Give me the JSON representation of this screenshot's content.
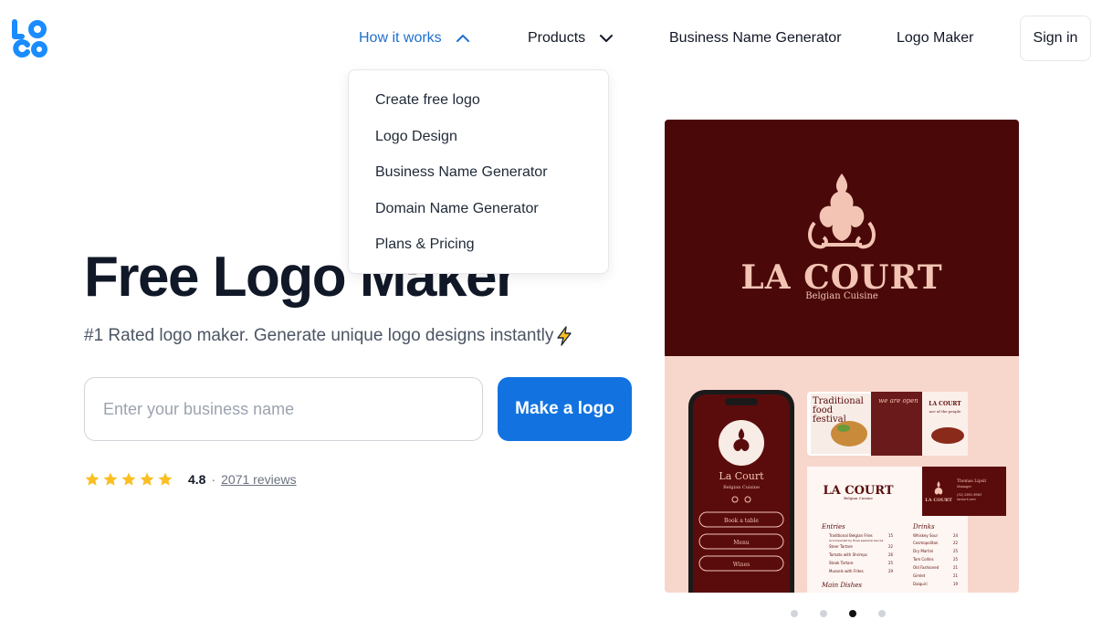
{
  "brand": {
    "logo_letters": [
      "L",
      "O",
      "G",
      "O"
    ],
    "color": "#1a8cff"
  },
  "nav": {
    "how_it_works": "How it works",
    "products": "Products",
    "business_name_generator": "Business Name Generator",
    "logo_maker": "Logo Maker",
    "sign_in": "Sign in",
    "active_color": "#1f6fd1"
  },
  "dropdown": {
    "items": [
      "Create free logo",
      "Logo Design",
      "Business Name Generator",
      "Domain Name Generator",
      "Plans & Pricing"
    ]
  },
  "hero": {
    "title": "Free Logo Maker",
    "subtitle": "#1 Rated logo maker. Generate unique logo designs instantly",
    "input_placeholder": "Enter your business name",
    "input_value": "",
    "cta": "Make a logo",
    "cta_color": "#1273e0"
  },
  "rating": {
    "stars": 5,
    "score": "4.8",
    "separator": "·",
    "reviews": "2071 reviews",
    "star_color": "#fbbf24"
  },
  "showcase": {
    "brand_name": "LA COURT",
    "brand_tagline": "Belgian Cuisine",
    "phone_name": "La Court",
    "phone_tagline": "Belgian Cuisine",
    "phone_buttons": [
      "Book a table",
      "Menu",
      "Wines"
    ],
    "card1_text": [
      "Traditional",
      "food",
      "festival"
    ],
    "card2_text": "we are open",
    "card3_brand": "LA COURT",
    "card3_text": "ace of the people",
    "menu_brand": "LA COURT",
    "menu_tagline": "Belgian Cuisine",
    "menu_entries_title": "Entries",
    "menu_entries": [
      [
        "Traditional Belgian Fries",
        "15"
      ],
      [
        "Accompanied by three seasonal sauces",
        ""
      ],
      [
        "Steer Tartare",
        "22"
      ],
      [
        "Tomato with Shrimps",
        "26"
      ],
      [
        "Steak Tartare",
        "25"
      ],
      [
        "Mussels with Frites",
        "29"
      ]
    ],
    "menu_drinks_title": "Drinks",
    "menu_drinks": [
      [
        "Whiskey Sour",
        "24"
      ],
      [
        "Cosmopolitan",
        "22"
      ],
      [
        "Dry Martini",
        "25"
      ],
      [
        "Tom Collins",
        "25"
      ],
      [
        "Old Fashioned",
        "21"
      ],
      [
        "Gimlet",
        "21"
      ],
      [
        "Daiquiri",
        "19"
      ]
    ],
    "menu_main_title": "Main Dishes",
    "bizcard_brand": "LA COURT",
    "bizcard_name": "Thomas Lipsit",
    "bizcard_role": "Manager",
    "bizcard_phone": "(32) 2891 8963",
    "bizcard_web": "lacourt.com",
    "colors": {
      "maroon": "#4a0808",
      "pink": "#f7d6cc",
      "cream": "#f3c4b4"
    }
  },
  "carousel": {
    "count": 4,
    "active_index": 2
  }
}
